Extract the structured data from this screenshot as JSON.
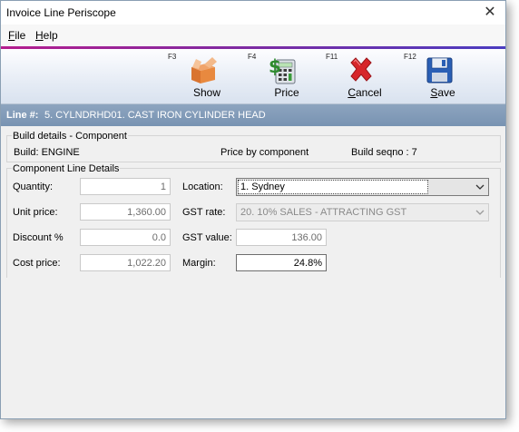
{
  "window": {
    "title": "Invoice Line Periscope",
    "close_glyph": "✕"
  },
  "menu": [
    {
      "label": "File",
      "accel": "F",
      "rest": "ile"
    },
    {
      "label": "Help",
      "accel": "H",
      "rest": "elp"
    }
  ],
  "toolbar": [
    {
      "fkey": "F3",
      "label": "Show",
      "accel": "",
      "rest": "Show",
      "icon": "box-show-icon"
    },
    {
      "fkey": "F4",
      "label": "Price",
      "accel": "",
      "rest": "Price",
      "icon": "price-calculator-icon"
    },
    {
      "fkey": "F11",
      "label": "Cancel",
      "accel": "C",
      "rest": "ancel",
      "icon": "cancel-x-icon"
    },
    {
      "fkey": "F12",
      "label": "Save",
      "accel": "S",
      "rest": "ave",
      "icon": "save-disk-icon"
    }
  ],
  "line": {
    "label": "Line #:",
    "value": "5. CYLNDRHD01. CAST IRON CYLINDER HEAD"
  },
  "build_details": {
    "title": "Build details - Component",
    "build": "Build: ENGINE",
    "price_by": "Price by component",
    "seqno": "Build seqno : 7"
  },
  "component": {
    "title": "Component Line Details",
    "quantity_label": "Quantity:",
    "quantity": "1",
    "unit_price_label": "Unit price:",
    "unit_price": "1,360.00",
    "discount_label": "Discount %",
    "discount": "0.0",
    "cost_price_label": "Cost price:",
    "cost_price": "1,022.20",
    "location_label": "Location:",
    "location": "1. Sydney",
    "gst_rate_label": "GST rate:",
    "gst_rate": "20. 10% SALES - ATTRACTING GST",
    "gst_value_label": "GST value:",
    "gst_value": "136.00",
    "margin_label": "Margin:",
    "margin": "24.8%"
  }
}
